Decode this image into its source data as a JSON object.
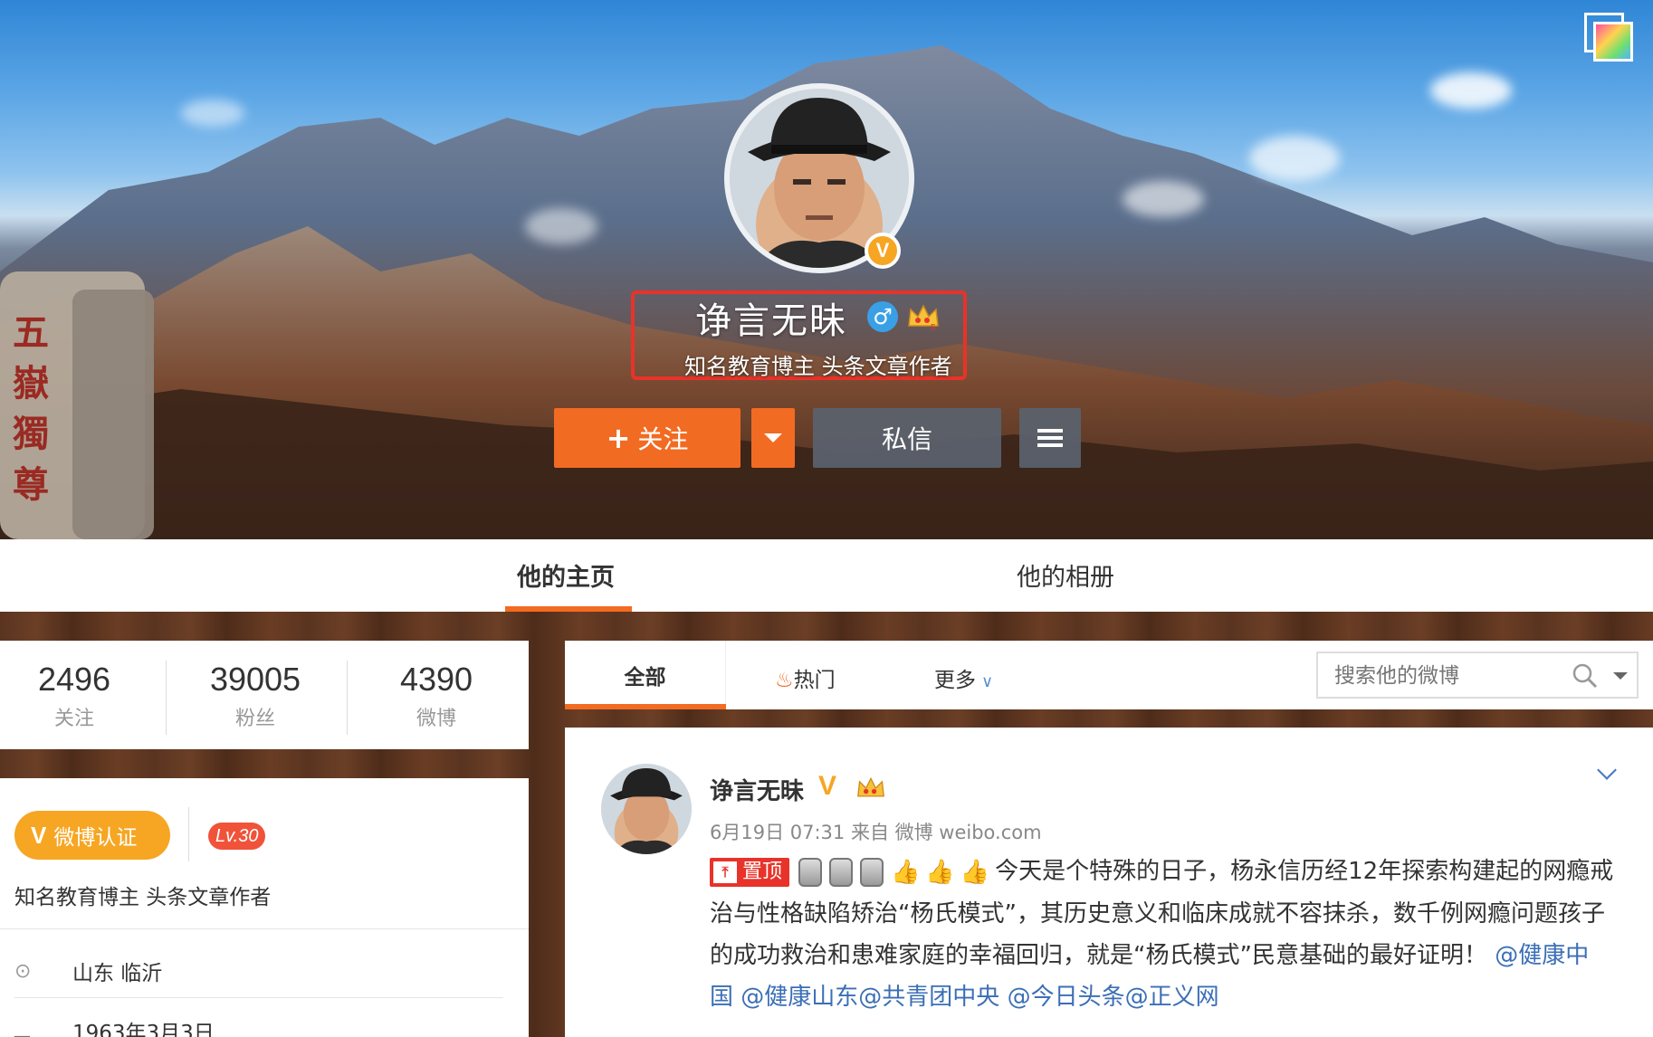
{
  "cover": {
    "profile_name": "诤言无昧",
    "verified_badge": "V",
    "gender_icon": "♂",
    "description": "知名教育博主 头条文章作者",
    "follow_label": "关注",
    "message_label": "私信",
    "stone_text": "五嶽獨尊"
  },
  "tabs": {
    "home": "他的主页",
    "album": "他的相册"
  },
  "stats": {
    "following": "2496",
    "following_label": "关注",
    "followers": "39005",
    "followers_label": "粉丝",
    "posts": "4390",
    "posts_label": "微博"
  },
  "info": {
    "verify_label": "微博认证",
    "level": "Lv.30",
    "description": "知名教育博主 头条文章作者",
    "location": "山东 临沂",
    "birthday": "1963年3月3日"
  },
  "feed": {
    "tab_all": "全部",
    "tab_hot": "热门",
    "tab_more": "更多",
    "search_placeholder": "搜索他的微博"
  },
  "post": {
    "author": "诤言无昧",
    "meta": "6月19日 07:31 来自 微博 weibo.com",
    "pin_label": "置顶",
    "text_1": "今天是个特殊的日子，杨永信历经12年探索构建起的网瘾戒治与性格缺陷矫治“杨氏模式”，其历史意义和临床成就不容抹杀，数千例网瘾问题孩子的成功救治和患难家庭的幸福回归，就是“杨氏模式”民意基础的最好证明！",
    "mention_1": "@健康中国",
    "mention_2": "@健康山东",
    "mention_3": "@共青团中央",
    "mention_4": "@今日头条",
    "mention_5": "@正义网"
  },
  "colors": {
    "accent_orange": "#f26b22",
    "verified_gold": "#f6a623",
    "highlight_red": "#e8332a",
    "link_blue": "#3b6fb6"
  },
  "icons": [
    "switch-cover-icon",
    "verified-icon",
    "gender-male-icon",
    "vip-crown-icon",
    "chevron-down-icon",
    "menu-icon",
    "location-icon",
    "birthday-icon",
    "search-icon",
    "flame-icon",
    "pin-icon"
  ]
}
